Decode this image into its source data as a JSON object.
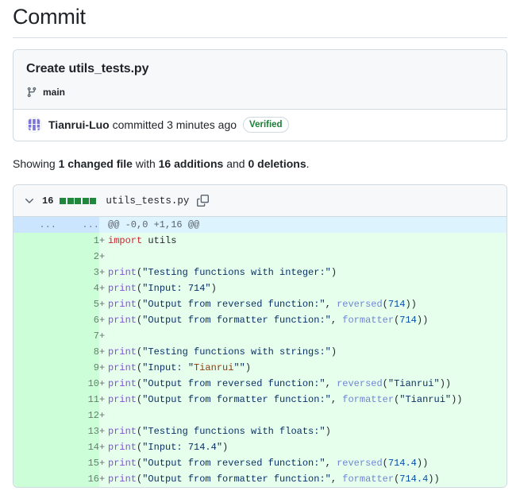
{
  "page": {
    "title": "Commit"
  },
  "commit": {
    "message": "Create utils_tests.py",
    "branch": "main",
    "branch_icon": "git-branch-icon",
    "author": "Tianrui-Luo",
    "action_text": " committed 3 minutes ago ",
    "verified_label": "Verified",
    "avatar_alt": "avatar"
  },
  "summary": {
    "prefix": "Showing ",
    "changed_files": "1 changed file",
    "mid": " with ",
    "additions": "16 additions",
    "conj": " and ",
    "deletions": "0 deletions",
    "suffix": "."
  },
  "diff": {
    "chevron_icon": "chevron-down-icon",
    "change_count": "16",
    "stat_blocks": 5,
    "stat_block_color": "#1f883d",
    "filename": "utils_tests.py",
    "copy_icon": "copy-icon",
    "hunk": {
      "old_gutter": "...",
      "new_gutter": "...",
      "header": "@@ -0,0 +1,16 @@"
    },
    "lines": [
      {
        "n": "1",
        "marker": "+",
        "tokens": [
          {
            "t": "import",
            "c": "kw"
          },
          {
            "t": " utils",
            "c": "var"
          }
        ]
      },
      {
        "n": "2",
        "marker": "+",
        "tokens": []
      },
      {
        "n": "3",
        "marker": "+",
        "tokens": [
          {
            "t": "print",
            "c": "fn"
          },
          {
            "t": "(",
            "c": "plain"
          },
          {
            "t": "\"Testing functions with integer:\"",
            "c": "str"
          },
          {
            "t": ")",
            "c": "plain"
          }
        ]
      },
      {
        "n": "4",
        "marker": "+",
        "tokens": [
          {
            "t": "print",
            "c": "fn"
          },
          {
            "t": "(",
            "c": "plain"
          },
          {
            "t": "\"Input: 714\"",
            "c": "str"
          },
          {
            "t": ")",
            "c": "plain"
          }
        ]
      },
      {
        "n": "5",
        "marker": "+",
        "tokens": [
          {
            "t": "print",
            "c": "fn"
          },
          {
            "t": "(",
            "c": "plain"
          },
          {
            "t": "\"Output from reversed function:\"",
            "c": "str"
          },
          {
            "t": ", ",
            "c": "plain"
          },
          {
            "t": "reversed",
            "c": "call"
          },
          {
            "t": "(",
            "c": "plain"
          },
          {
            "t": "714",
            "c": "num"
          },
          {
            "t": "))",
            "c": "plain"
          }
        ]
      },
      {
        "n": "6",
        "marker": "+",
        "tokens": [
          {
            "t": "print",
            "c": "fn"
          },
          {
            "t": "(",
            "c": "plain"
          },
          {
            "t": "\"Output from formatter function:\"",
            "c": "str"
          },
          {
            "t": ", ",
            "c": "plain"
          },
          {
            "t": "formatter",
            "c": "call"
          },
          {
            "t": "(",
            "c": "plain"
          },
          {
            "t": "714",
            "c": "num"
          },
          {
            "t": "))",
            "c": "plain"
          }
        ]
      },
      {
        "n": "7",
        "marker": "+",
        "tokens": []
      },
      {
        "n": "8",
        "marker": "+",
        "tokens": [
          {
            "t": "print",
            "c": "fn"
          },
          {
            "t": "(",
            "c": "plain"
          },
          {
            "t": "\"Testing functions with strings:\"",
            "c": "str"
          },
          {
            "t": ")",
            "c": "plain"
          }
        ]
      },
      {
        "n": "9",
        "marker": "+",
        "tokens": [
          {
            "t": "print",
            "c": "fn"
          },
          {
            "t": "(",
            "c": "plain"
          },
          {
            "t": "\"Input: \"",
            "c": "str"
          },
          {
            "t": "Tianrui",
            "c": "err"
          },
          {
            "t": "\"\"",
            "c": "str"
          },
          {
            "t": ")",
            "c": "plain"
          }
        ]
      },
      {
        "n": "10",
        "marker": "+",
        "tokens": [
          {
            "t": "print",
            "c": "fn"
          },
          {
            "t": "(",
            "c": "plain"
          },
          {
            "t": "\"Output from reversed function:\"",
            "c": "str"
          },
          {
            "t": ", ",
            "c": "plain"
          },
          {
            "t": "reversed",
            "c": "call"
          },
          {
            "t": "(",
            "c": "plain"
          },
          {
            "t": "\"Tianrui\"",
            "c": "str"
          },
          {
            "t": "))",
            "c": "plain"
          }
        ]
      },
      {
        "n": "11",
        "marker": "+",
        "tokens": [
          {
            "t": "print",
            "c": "fn"
          },
          {
            "t": "(",
            "c": "plain"
          },
          {
            "t": "\"Output from formatter function:\"",
            "c": "str"
          },
          {
            "t": ", ",
            "c": "plain"
          },
          {
            "t": "formatter",
            "c": "call"
          },
          {
            "t": "(",
            "c": "plain"
          },
          {
            "t": "\"Tianrui\"",
            "c": "str"
          },
          {
            "t": "))",
            "c": "plain"
          }
        ]
      },
      {
        "n": "12",
        "marker": "+",
        "tokens": []
      },
      {
        "n": "13",
        "marker": "+",
        "tokens": [
          {
            "t": "print",
            "c": "fn"
          },
          {
            "t": "(",
            "c": "plain"
          },
          {
            "t": "\"Testing functions with floats:\"",
            "c": "str"
          },
          {
            "t": ")",
            "c": "plain"
          }
        ]
      },
      {
        "n": "14",
        "marker": "+",
        "tokens": [
          {
            "t": "print",
            "c": "fn"
          },
          {
            "t": "(",
            "c": "plain"
          },
          {
            "t": "\"Input: 714.4\"",
            "c": "str"
          },
          {
            "t": ")",
            "c": "plain"
          }
        ]
      },
      {
        "n": "15",
        "marker": "+",
        "tokens": [
          {
            "t": "print",
            "c": "fn"
          },
          {
            "t": "(",
            "c": "plain"
          },
          {
            "t": "\"Output from reversed function:\"",
            "c": "str"
          },
          {
            "t": ", ",
            "c": "plain"
          },
          {
            "t": "reversed",
            "c": "call"
          },
          {
            "t": "(",
            "c": "plain"
          },
          {
            "t": "714.4",
            "c": "num"
          },
          {
            "t": "))",
            "c": "plain"
          }
        ]
      },
      {
        "n": "16",
        "marker": "+",
        "tokens": [
          {
            "t": "print",
            "c": "fn"
          },
          {
            "t": "(",
            "c": "plain"
          },
          {
            "t": "\"Output from formatter function:\"",
            "c": "str"
          },
          {
            "t": ", ",
            "c": "plain"
          },
          {
            "t": "formatter",
            "c": "call"
          },
          {
            "t": "(",
            "c": "plain"
          },
          {
            "t": "714.4",
            "c": "num"
          },
          {
            "t": "))",
            "c": "plain"
          }
        ]
      }
    ]
  },
  "colors": {
    "accent": "#0969da",
    "success": "#1a7f37",
    "addition_bg": "#e6ffec",
    "addition_gutter_bg": "#ccffd8",
    "hunk_bg": "#ddf4ff",
    "hunk_gutter_bg": "#cce5ff",
    "border": "#d1d9e0",
    "subtle_bg": "#f6f8fa"
  }
}
